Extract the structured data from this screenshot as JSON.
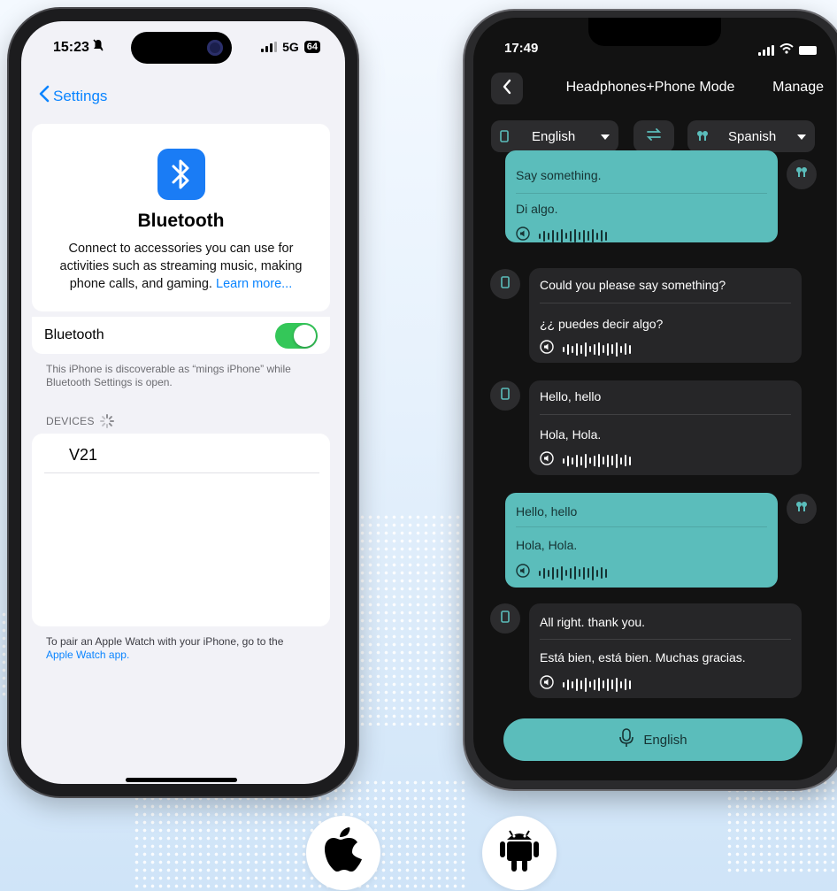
{
  "ios": {
    "time": "15:23",
    "network": "5G",
    "battery": "64",
    "back_label": "Settings",
    "bt_title": "Bluetooth",
    "bt_desc": "Connect to accessories you can use for activities such as streaming music, making phone calls, and gaming.",
    "learn_more": "Learn more...",
    "toggle_label": "Bluetooth",
    "toggle_on": true,
    "discoverable_hint": "This iPhone is discoverable as “mings iPhone” while Bluetooth Settings is open.",
    "devices_header": "DEVICES",
    "devices": [
      "V21"
    ],
    "footer_text": "To pair an Apple Watch with your iPhone, go to the",
    "footer_link": "Apple Watch app."
  },
  "app": {
    "time": "17:49",
    "title": "Headphones+Phone Mode",
    "manage_label": "Manage",
    "lang_left": "English",
    "lang_right": "Spanish",
    "messages": [
      {
        "side": "right",
        "style": "teal",
        "source": "Say something.",
        "translation": "Di algo."
      },
      {
        "side": "left",
        "style": "dark",
        "source": "Could you please say something?",
        "translation": "¿¿ puedes decir algo?"
      },
      {
        "side": "left",
        "style": "dark",
        "source": "Hello, hello",
        "translation": "Hola, Hola."
      },
      {
        "side": "right",
        "style": "teal",
        "source": "Hello, hello",
        "translation": "Hola, Hola."
      },
      {
        "side": "left",
        "style": "dark",
        "source": "All right. thank you.",
        "translation": "Está bien, está bien. Muchas gracias."
      }
    ],
    "mic_label": "English"
  },
  "colors": {
    "ios_blue": "#0a84ff",
    "ios_green": "#34c759",
    "teal": "#5bbdbb",
    "dark_bubble": "#262628"
  },
  "icons": [
    "bluetooth-icon",
    "chevron-left-icon",
    "phone-icon",
    "earbuds-icon",
    "swap-icon",
    "speaker-icon",
    "microphone-icon",
    "apple-logo-icon",
    "android-logo-icon"
  ]
}
